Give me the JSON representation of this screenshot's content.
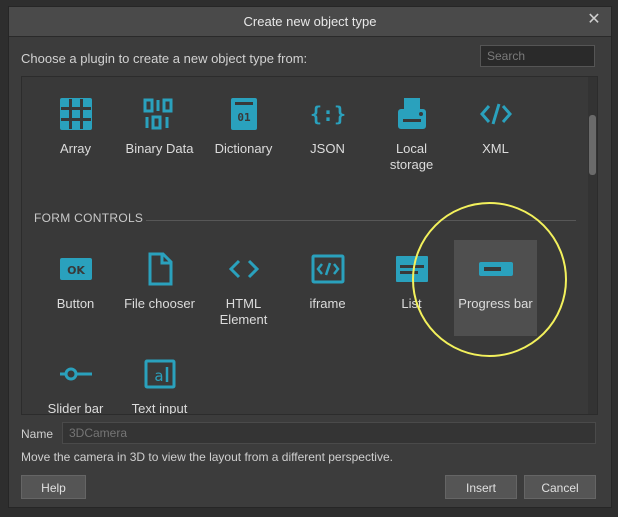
{
  "dialog": {
    "title": "Create new object type",
    "prompt": "Choose a plugin to create a new object type from:",
    "search_placeholder": "Search"
  },
  "sections": [
    {
      "label": "",
      "items": [
        {
          "label": "Array",
          "icon": "grid-icon"
        },
        {
          "label": "Binary Data",
          "icon": "binary-icon"
        },
        {
          "label": "Dictionary",
          "icon": "dictionary-icon"
        },
        {
          "label": "JSON",
          "icon": "json-icon"
        },
        {
          "label": "Local storage",
          "icon": "storage-icon"
        },
        {
          "label": "XML",
          "icon": "xml-icon"
        }
      ]
    },
    {
      "label": "FORM CONTROLS",
      "items": [
        {
          "label": "Button",
          "icon": "ok-button-icon"
        },
        {
          "label": "File chooser",
          "icon": "file-icon"
        },
        {
          "label": "HTML Element",
          "icon": "html-icon"
        },
        {
          "label": "iframe",
          "icon": "iframe-icon"
        },
        {
          "label": "List",
          "icon": "list-icon"
        },
        {
          "label": "Progress bar",
          "icon": "progress-icon",
          "selected": true
        },
        {
          "label": "Slider bar",
          "icon": "slider-icon"
        },
        {
          "label": "Text input",
          "icon": "text-input-icon"
        }
      ]
    }
  ],
  "name": {
    "label": "Name",
    "placeholder": "3DCamera"
  },
  "description": "Move the camera in 3D to view the layout from a different perspective.",
  "buttons": {
    "help": "Help",
    "insert": "Insert",
    "cancel": "Cancel"
  },
  "colors": {
    "accent": "#2aa1bd",
    "highlight": "#f3f15c"
  }
}
